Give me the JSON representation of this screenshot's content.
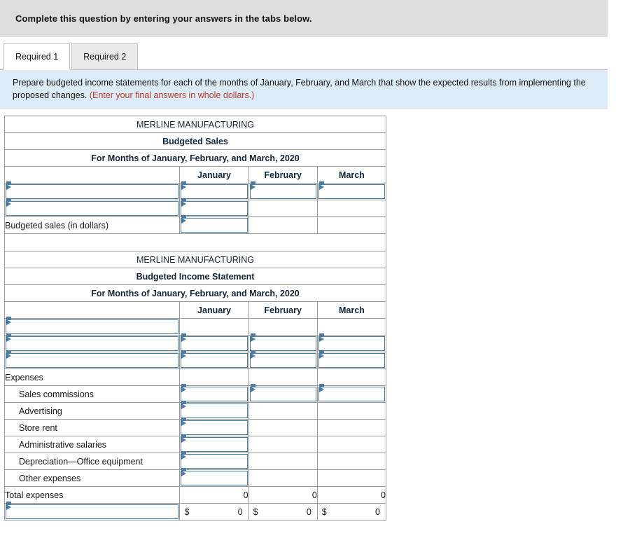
{
  "banner": {
    "text": "Complete this question by entering your answers in the tabs below."
  },
  "tabs": [
    {
      "label": "Required 1",
      "active": true
    },
    {
      "label": "Required 2",
      "active": false
    }
  ],
  "prompt": {
    "text": "Prepare budgeted income statements for each of the months of January, February, and March that show the expected results from implementing the proposed changes. ",
    "red_note": "(Enter your final answers in whole dollars.)"
  },
  "colors": {
    "header_blue": "#7eabdd",
    "banner_gray": "#dddddd",
    "prompt_blue": "#dbecf8",
    "field_border": "#4a7ba7",
    "red_note": "#c0392b"
  },
  "sales_table": {
    "title_line1": "MERLINE MANUFACTURING",
    "title_line2": "Budgeted Sales",
    "title_line3": "For Months of January, February, and March, 2020",
    "columns": [
      "",
      "January",
      "February",
      "March"
    ],
    "rows": [
      {
        "label": "",
        "label_widget": "select",
        "january": "",
        "jan_widget": "select",
        "february": "",
        "feb_widget": "select",
        "march": "",
        "mar_widget": "select"
      },
      {
        "label": "",
        "label_widget": "select",
        "january": "",
        "jan_widget": "select",
        "february": "",
        "feb_widget": "none",
        "march": "",
        "mar_widget": "none"
      },
      {
        "label": "Budgeted sales (in dollars)",
        "label_widget": "none",
        "january": "",
        "jan_widget": "select",
        "february": "",
        "feb_widget": "none",
        "march": "",
        "mar_widget": "none"
      }
    ]
  },
  "income_table": {
    "title_line1": "MERLINE MANUFACTURING",
    "title_line2": "Budgeted Income Statement",
    "title_line3": "For Months of January, February, and March, 2020",
    "columns": [
      "",
      "January",
      "February",
      "March"
    ],
    "rows": [
      {
        "label": "",
        "label_widget": "select",
        "january": "",
        "jan_widget": "none",
        "february": "",
        "feb_widget": "none",
        "march": "",
        "mar_widget": "none"
      },
      {
        "label": "",
        "label_widget": "select",
        "january": "",
        "jan_widget": "select",
        "february": "",
        "feb_widget": "select",
        "march": "",
        "mar_widget": "select"
      },
      {
        "label": "",
        "label_widget": "select",
        "january": "",
        "jan_widget": "select",
        "february": "",
        "feb_widget": "select",
        "march": "",
        "mar_widget": "select"
      },
      {
        "label": "Expenses",
        "label_widget": "none",
        "january": "",
        "jan_widget": "none",
        "february": "",
        "feb_widget": "none",
        "march": "",
        "mar_widget": "none"
      },
      {
        "label": "Sales commissions",
        "indent": true,
        "label_widget": "none",
        "january": "",
        "jan_widget": "select",
        "february": "",
        "feb_widget": "select",
        "march": "",
        "mar_widget": "select"
      },
      {
        "label": "Advertising",
        "indent": true,
        "label_widget": "none",
        "january": "",
        "jan_widget": "select",
        "february": "",
        "feb_widget": "none",
        "march": "",
        "mar_widget": "none"
      },
      {
        "label": "Store rent",
        "indent": true,
        "label_widget": "none",
        "january": "",
        "jan_widget": "select",
        "february": "",
        "feb_widget": "none",
        "march": "",
        "mar_widget": "none"
      },
      {
        "label": "Administrative salaries",
        "indent": true,
        "label_widget": "none",
        "january": "",
        "jan_widget": "select",
        "february": "",
        "feb_widget": "none",
        "march": "",
        "mar_widget": "none"
      },
      {
        "label": "Depreciation—Office equipment",
        "indent": true,
        "label_widget": "none",
        "january": "",
        "jan_widget": "select",
        "february": "",
        "feb_widget": "none",
        "march": "",
        "mar_widget": "none"
      },
      {
        "label": "Other expenses",
        "indent": true,
        "label_widget": "none",
        "january": "",
        "jan_widget": "select",
        "february": "",
        "feb_widget": "none",
        "march": "",
        "mar_widget": "none"
      }
    ],
    "total_row": {
      "label": "Total expenses",
      "january": "0",
      "february": "0",
      "march": "0"
    },
    "net_row": {
      "label": "",
      "label_widget": "select",
      "currency": "$",
      "january": "0",
      "february": "0",
      "march": "0"
    }
  }
}
